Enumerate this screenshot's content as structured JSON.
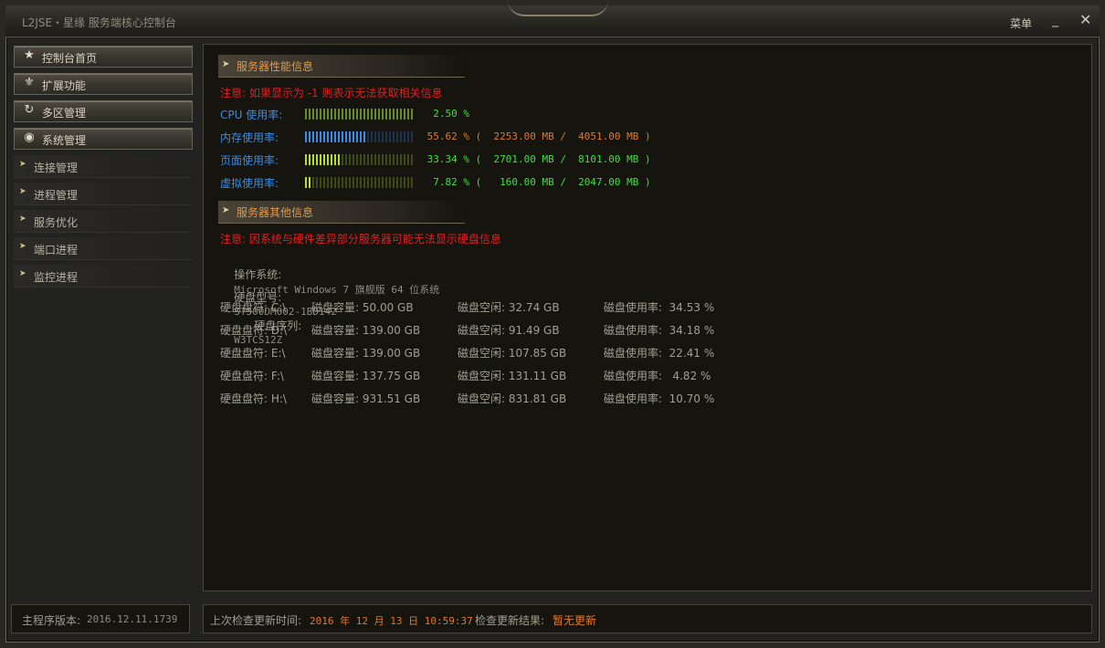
{
  "window": {
    "title": "L2JSE・星缘 服务端核心控制台",
    "menu_label": "菜单",
    "minimize_glyph": "_",
    "close_glyph": "✕"
  },
  "sidebar": {
    "buttons": [
      {
        "label": "控制台首页",
        "icon": "star-icon"
      },
      {
        "label": "扩展功能",
        "icon": "fleur-icon"
      },
      {
        "label": "多区管理",
        "icon": "refresh-icon"
      },
      {
        "label": "系统管理",
        "icon": "eye-icon"
      }
    ],
    "sub_items": [
      {
        "label": "连接管理"
      },
      {
        "label": "进程管理"
      },
      {
        "label": "服务优化"
      },
      {
        "label": "端口进程"
      },
      {
        "label": "监控进程"
      }
    ]
  },
  "performance": {
    "heading": "服务器性能信息",
    "notice": "注意: 如果显示为 -1 则表示无法获取相关信息",
    "rows": [
      {
        "label": "CPU 使用率:",
        "percent": 2.5,
        "text": "  2.50 %",
        "label_color": "#3a8ce8",
        "value_color": "#3fe03f",
        "fill_color": "#6a8a22",
        "empty_color": "#3d4a18"
      },
      {
        "label": "内存使用率:",
        "percent": 55.62,
        "text": " 55.62 % (  2253.00 MB /  4051.00 MB )",
        "label_color": "#3a8ce8",
        "value_color": "#e07a2a",
        "fill_color": "#3a8ce8",
        "empty_color": "#1c3450"
      },
      {
        "label": "页面使用率:",
        "percent": 33.34,
        "text": " 33.34 % (  2701.00 MB /  8101.00 MB )",
        "label_color": "#3a8ce8",
        "value_color": "#3fe03f",
        "fill_color": "#b8e020",
        "empty_color": "#3d4a18"
      },
      {
        "label": "虚拟使用率:",
        "percent": 7.82,
        "text": "  7.82 % (   160.00 MB /  2047.00 MB )",
        "label_color": "#3a8ce8",
        "value_color": "#3fe03f",
        "fill_color": "#b8e020",
        "empty_color": "#3d4a18"
      }
    ]
  },
  "other": {
    "heading": "服务器其他信息",
    "notice": "注意: 因系统与硬件差异部分服务器可能无法显示硬盘信息",
    "os_label": "操作系统:",
    "os_value": "Microsoft Windows 7 旗舰版 64 位系统",
    "disk_model_label": "硬盘型号:",
    "disk_model_value": "ST500DM002-1BD142",
    "disk_serial_label": "硬盘序列:",
    "disk_serial_value": "W3TCS12Z",
    "disks": [
      {
        "drive": "硬盘盘符: C:\\",
        "capacity": "磁盘容量: 50.00 GB",
        "free": "磁盘空闲: 32.74 GB",
        "usage": "磁盘使用率:  34.53 %"
      },
      {
        "drive": "硬盘盘符: D:\\",
        "capacity": "磁盘容量: 139.00 GB",
        "free": "磁盘空闲: 91.49 GB",
        "usage": "磁盘使用率:  34.18 %"
      },
      {
        "drive": "硬盘盘符: E:\\",
        "capacity": "磁盘容量: 139.00 GB",
        "free": "磁盘空闲: 107.85 GB",
        "usage": "磁盘使用率:  22.41 %"
      },
      {
        "drive": "硬盘盘符: F:\\",
        "capacity": "磁盘容量: 137.75 GB",
        "free": "磁盘空闲: 131.11 GB",
        "usage": "磁盘使用率:   4.82 %"
      },
      {
        "drive": "硬盘盘符: H:\\",
        "capacity": "磁盘容量: 931.51 GB",
        "free": "磁盘空闲: 831.81 GB",
        "usage": "磁盘使用率:  10.70 %"
      }
    ]
  },
  "footer": {
    "version_label": "主程序版本:",
    "version_value": "2016.12.11.1739",
    "last_check_label": "上次检查更新时间:",
    "last_check_value": "2016 年 12 月 13 日 10:59:37",
    "check_result_label": "检查更新结果:",
    "check_result_value": "暂无更新"
  }
}
